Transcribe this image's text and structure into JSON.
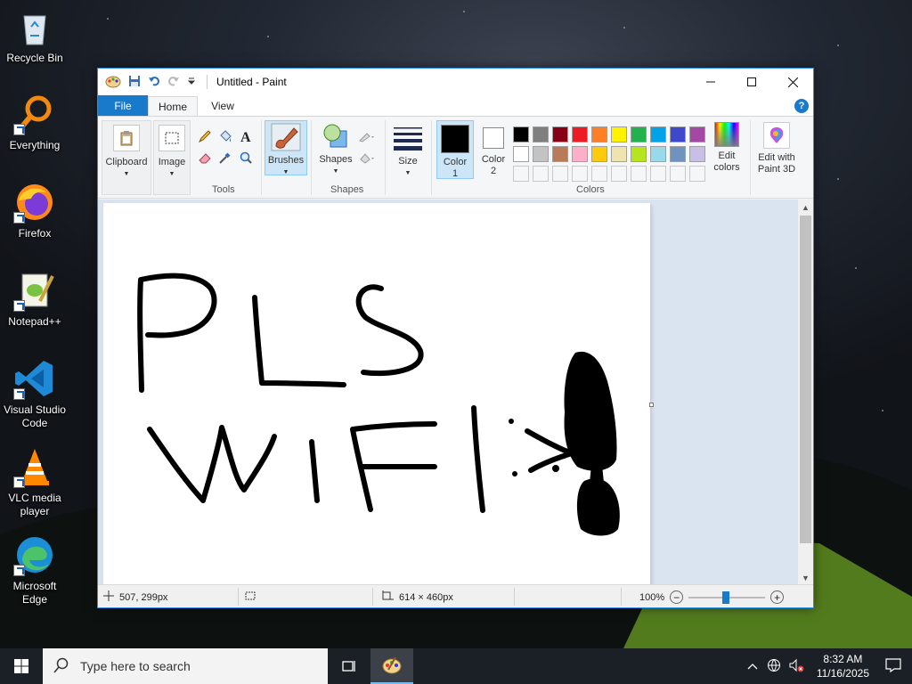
{
  "desktop": {
    "icons": [
      {
        "label": "Recycle Bin",
        "icon": "recycle-bin-icon"
      },
      {
        "label": "Everything",
        "icon": "everything-search-icon"
      },
      {
        "label": "Firefox",
        "icon": "firefox-icon"
      },
      {
        "label": "Notepad++",
        "icon": "notepadpp-icon"
      },
      {
        "label": "Visual Studio Code",
        "icon": "vscode-icon"
      },
      {
        "label": "VLC media player",
        "icon": "vlc-icon"
      },
      {
        "label": "Microsoft Edge",
        "icon": "edge-icon"
      }
    ]
  },
  "window": {
    "title": "Untitled - Paint",
    "tabs": {
      "file": "File",
      "home": "Home",
      "view": "View"
    },
    "ribbon": {
      "clipboard": "Clipboard",
      "image": "Image",
      "tools": "Tools",
      "brushes": "Brushes",
      "shapes": "Shapes",
      "shapes_group": "Shapes",
      "size": "Size",
      "color1": "Color 1",
      "color2": "Color 2",
      "edit_colors": "Edit colors",
      "edit_paint3d": "Edit with Paint 3D",
      "colors_group": "Colors"
    },
    "palette_row1": [
      "#000000",
      "#7f7f7f",
      "#880015",
      "#ed1c24",
      "#ff7f27",
      "#fff200",
      "#22b14c",
      "#00a2e8",
      "#3f48cc",
      "#a349a4"
    ],
    "palette_row2": [
      "#ffffff",
      "#c3c3c3",
      "#b97a57",
      "#ffaec9",
      "#ffc90e",
      "#efe4b0",
      "#b5e61d",
      "#99d9ea",
      "#7092be",
      "#c8bfe7"
    ],
    "color1_value": "#000000",
    "color2_value": "#ffffff",
    "status": {
      "cursor_pos": "507, 299px",
      "image_size": "614 × 460px",
      "zoom": "100%"
    }
  },
  "canvas_drawing": {
    "text_line1": "PLS",
    "text_line2": "WIFI!"
  },
  "taskbar": {
    "search_placeholder": "Type here to search",
    "time": "8:32 AM",
    "date": "11/16/2025"
  }
}
